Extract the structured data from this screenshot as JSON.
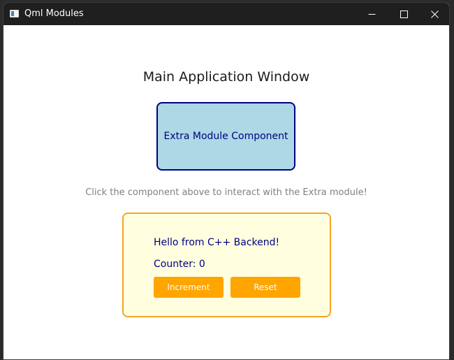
{
  "window": {
    "title": "Qml Modules"
  },
  "main": {
    "heading": "Main Application Window",
    "extra_component_label": "Extra Module Component",
    "hint": "Click the component above to interact with the Extra module!"
  },
  "backend": {
    "greeting": "Hello from C++ Backend!",
    "counter_text": "Counter: 0",
    "increment_label": "Increment",
    "reset_label": "Reset"
  },
  "colors": {
    "extra_fill": "#add8e6",
    "extra_border": "#000080",
    "backend_fill": "#ffffe0",
    "backend_border": "#f5a623",
    "button": "#ffa500"
  },
  "icons": [
    "app-icon",
    "minimize-icon",
    "maximize-icon",
    "close-icon"
  ]
}
